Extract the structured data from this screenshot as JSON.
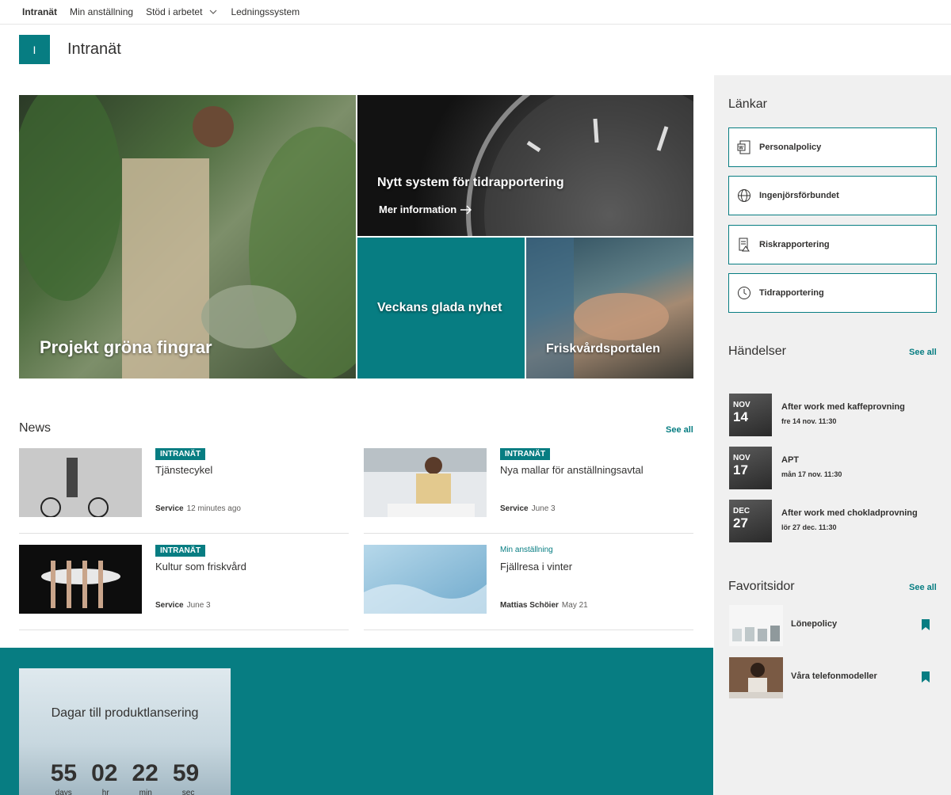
{
  "topnav": {
    "items": [
      "Intranät",
      "Min anställning",
      "Stöd i arbetet",
      "Ledningssystem"
    ]
  },
  "site": {
    "logo_letter": "I",
    "title": "Intranät"
  },
  "hero": {
    "tile1": {
      "title": "Projekt gröna fingrar"
    },
    "tile2": {
      "title": "Nytt system för tidrapportering",
      "more": "Mer information"
    },
    "tile3": {
      "title": "Veckans glada nyhet"
    },
    "tile4": {
      "title": "Friskvårdsportalen"
    }
  },
  "news": {
    "heading": "News",
    "see_all": "See all",
    "items": [
      {
        "badge": "INTRANÄT",
        "title": "Tjänstecykel",
        "author": "Service",
        "time": "12 minutes ago"
      },
      {
        "badge": "INTRANÄT",
        "title": "Nya mallar för anställningsavtal",
        "author": "Service",
        "time": "June 3"
      },
      {
        "badge": "INTRANÄT",
        "title": "Kultur som friskvård",
        "author": "Service",
        "time": "June 3"
      },
      {
        "category": "Min anställning",
        "title": "Fjällresa i vinter",
        "author": "Mattias Schöier",
        "time": "May 21"
      }
    ]
  },
  "countdown": {
    "title": "Dagar till produktlansering",
    "values": [
      "55",
      "02",
      "22",
      "59"
    ],
    "units": [
      "days",
      "hr",
      "min",
      "sec"
    ]
  },
  "sidebar": {
    "links_heading": "Länkar",
    "links": [
      {
        "label": "Personalpolicy",
        "icon": "word-doc-icon"
      },
      {
        "label": "Ingenjörsförbundet",
        "icon": "globe-icon"
      },
      {
        "label": "Riskrapportering",
        "icon": "report-icon"
      },
      {
        "label": "Tidrapportering",
        "icon": "clock-icon"
      }
    ],
    "events_heading": "Händelser",
    "events_see_all": "See all",
    "events": [
      {
        "month": "NOV",
        "day": "14",
        "title": "After work med kaffeprovning",
        "time": "fre 14 nov. 11:30"
      },
      {
        "month": "NOV",
        "day": "17",
        "title": "APT",
        "time": "mån 17 nov. 11:30"
      },
      {
        "month": "DEC",
        "day": "27",
        "title": "After work med chokladprovning",
        "time": "lör 27 dec. 11:30"
      }
    ],
    "fav_heading": "Favoritsidor",
    "fav_see_all": "See all",
    "favorites": [
      {
        "title": "Lönepolicy"
      },
      {
        "title": "Våra telefonmodeller"
      }
    ]
  },
  "colors": {
    "accent": "#077d82",
    "sidebar_bg": "#f0f0f0"
  }
}
